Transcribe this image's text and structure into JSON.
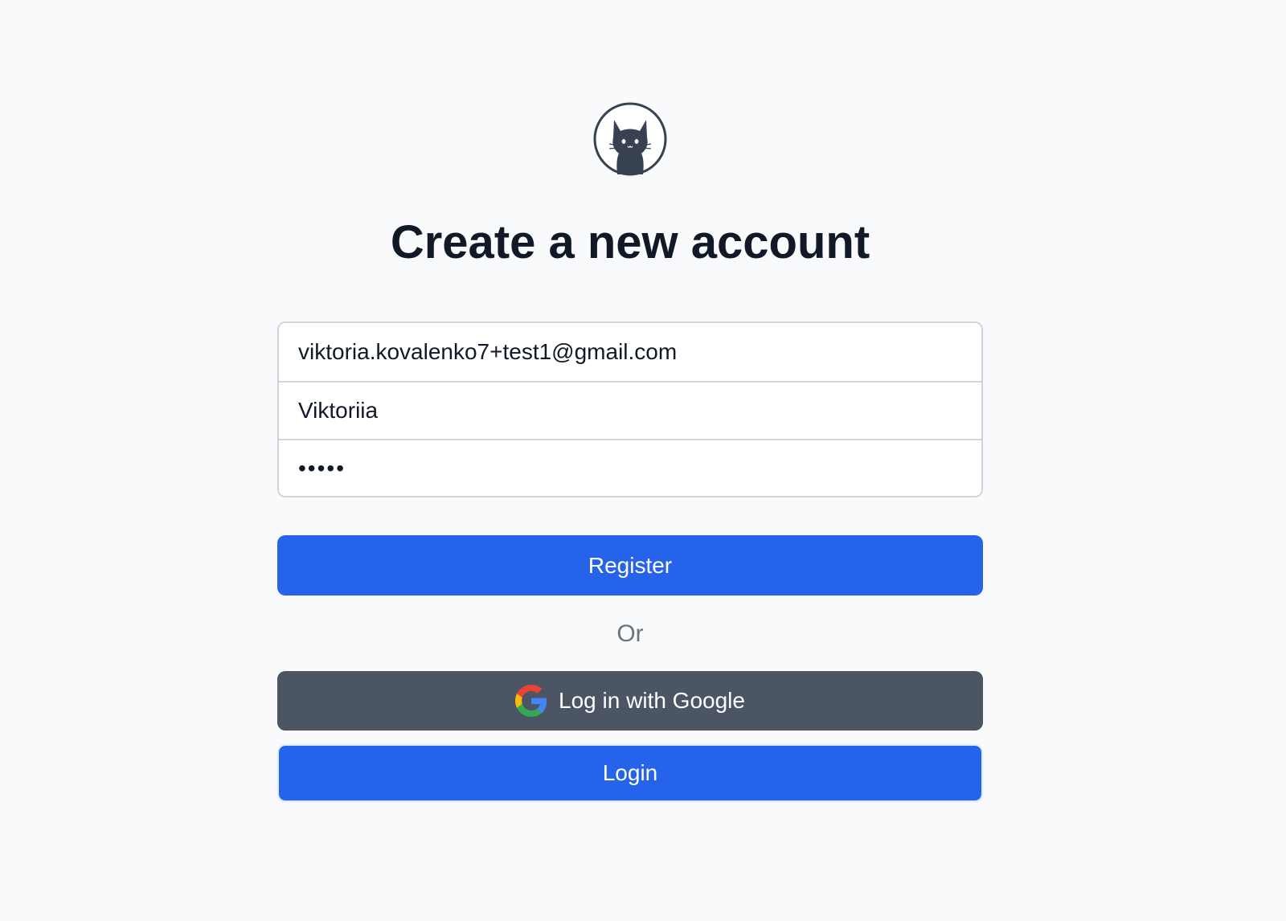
{
  "page": {
    "title": "Create a new account"
  },
  "logo": {
    "icon": "cat-icon"
  },
  "form": {
    "email_value": "viktoria.kovalenko7+test1@gmail.com",
    "name_value": "Viktoriia",
    "password_value": "•••••"
  },
  "buttons": {
    "register_label": "Register",
    "or_label": "Or",
    "google_label": "Log in with Google",
    "google_icon": "google-icon",
    "login_label": "Login"
  },
  "colors": {
    "primary": "#2563eb",
    "secondary": "#4b5563",
    "background": "#f9fafb",
    "heading": "#111827",
    "muted": "#6b7280"
  }
}
